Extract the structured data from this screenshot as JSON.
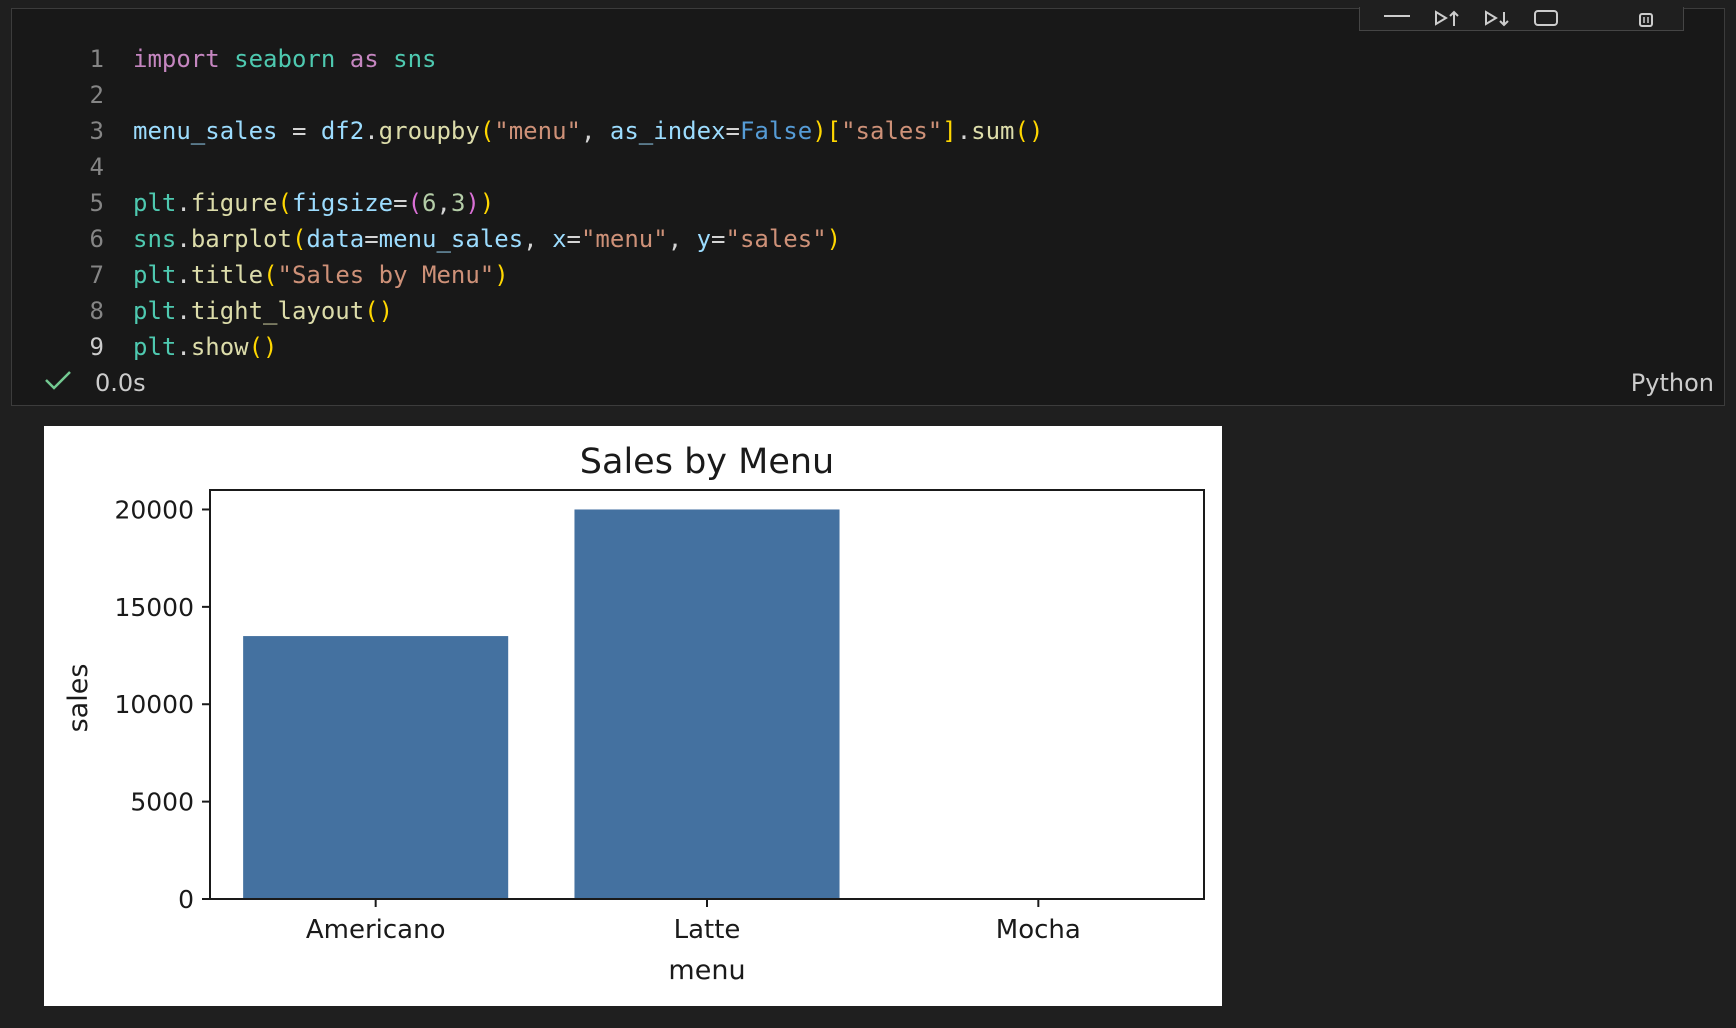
{
  "editor": {
    "lines": [
      {
        "n": "1",
        "tokens": [
          [
            "kw",
            "import"
          ],
          [
            "op",
            " "
          ],
          [
            "mod",
            "seaborn"
          ],
          [
            "op",
            " "
          ],
          [
            "kw",
            "as"
          ],
          [
            "op",
            " "
          ],
          [
            "mod",
            "sns"
          ]
        ]
      },
      {
        "n": "2",
        "tokens": []
      },
      {
        "n": "3",
        "tokens": [
          [
            "var",
            "menu_sales"
          ],
          [
            "op",
            " = "
          ],
          [
            "var",
            "df2"
          ],
          [
            "op",
            "."
          ],
          [
            "fn",
            "groupby"
          ],
          [
            "p1",
            "("
          ],
          [
            "str",
            "\"menu\""
          ],
          [
            "op",
            ", "
          ],
          [
            "var",
            "as_index"
          ],
          [
            "op",
            "="
          ],
          [
            "bool",
            "False"
          ],
          [
            "p1",
            ")"
          ],
          [
            "p1",
            "["
          ],
          [
            "str",
            "\"sales\""
          ],
          [
            "p1",
            "]"
          ],
          [
            "op",
            "."
          ],
          [
            "fn",
            "sum"
          ],
          [
            "p1",
            "()"
          ]
        ]
      },
      {
        "n": "4",
        "tokens": []
      },
      {
        "n": "5",
        "tokens": [
          [
            "mod",
            "plt"
          ],
          [
            "op",
            "."
          ],
          [
            "fn",
            "figure"
          ],
          [
            "p1",
            "("
          ],
          [
            "var",
            "figsize"
          ],
          [
            "op",
            "="
          ],
          [
            "p2",
            "("
          ],
          [
            "num",
            "6"
          ],
          [
            "op",
            ","
          ],
          [
            "num",
            "3"
          ],
          [
            "p2",
            ")"
          ],
          [
            "p1",
            ")"
          ]
        ]
      },
      {
        "n": "6",
        "tokens": [
          [
            "mod",
            "sns"
          ],
          [
            "op",
            "."
          ],
          [
            "fn",
            "barplot"
          ],
          [
            "p1",
            "("
          ],
          [
            "var",
            "data"
          ],
          [
            "op",
            "="
          ],
          [
            "var",
            "menu_sales"
          ],
          [
            "op",
            ", "
          ],
          [
            "var",
            "x"
          ],
          [
            "op",
            "="
          ],
          [
            "str",
            "\"menu\""
          ],
          [
            "op",
            ", "
          ],
          [
            "var",
            "y"
          ],
          [
            "op",
            "="
          ],
          [
            "str",
            "\"sales\""
          ],
          [
            "p1",
            ")"
          ]
        ]
      },
      {
        "n": "7",
        "tokens": [
          [
            "mod",
            "plt"
          ],
          [
            "op",
            "."
          ],
          [
            "fn",
            "title"
          ],
          [
            "p1",
            "("
          ],
          [
            "str",
            "\"Sales by Menu\""
          ],
          [
            "p1",
            ")"
          ]
        ]
      },
      {
        "n": "8",
        "tokens": [
          [
            "mod",
            "plt"
          ],
          [
            "op",
            "."
          ],
          [
            "fn",
            "tight_layout"
          ],
          [
            "p1",
            "()"
          ]
        ]
      },
      {
        "n": "9",
        "tokens": [
          [
            "mod",
            "plt"
          ],
          [
            "op",
            "."
          ],
          [
            "fn",
            "show"
          ],
          [
            "p1",
            "()"
          ]
        ]
      }
    ],
    "active_line": "9"
  },
  "status": {
    "timing": "0.0s",
    "language": "Python"
  },
  "icons": {
    "status_check": "checkmark-icon",
    "toolbar": [
      "menu-lines-icon",
      "run-above-icon",
      "run-below-icon",
      "split-cell-icon",
      "delete-icon"
    ]
  },
  "colors": {
    "background": "#1f1f1f",
    "bar": "#4471a0",
    "check": "#73c991"
  },
  "chart_data": {
    "type": "bar",
    "title": "Sales by Menu",
    "xlabel": "menu",
    "ylabel": "sales",
    "categories": [
      "Americano",
      "Latte",
      "Mocha"
    ],
    "values": [
      13500,
      20000,
      0
    ],
    "ylim": [
      0,
      21000
    ],
    "yticks": [
      0,
      5000,
      10000,
      15000,
      20000
    ],
    "ytick_labels": [
      "0",
      "5000",
      "10000",
      "15000",
      "20000"
    ],
    "grid": false
  }
}
